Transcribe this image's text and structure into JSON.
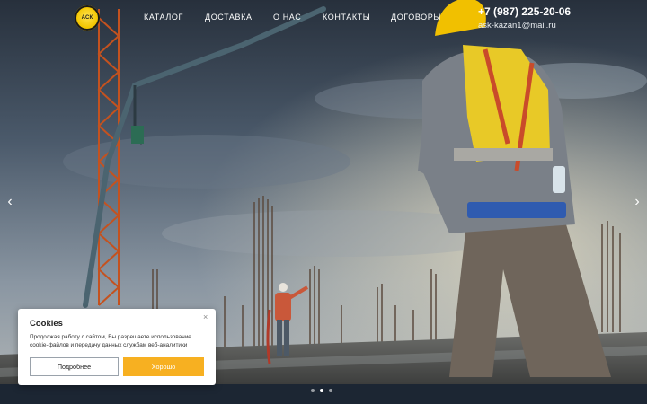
{
  "logo": {
    "text": "АСК",
    "icon": "company-logo"
  },
  "nav": {
    "items": [
      {
        "label": "КАТАЛОГ"
      },
      {
        "label": "ДОСТАВКА"
      },
      {
        "label": "О НАС"
      },
      {
        "label": "КОНТАКТЫ"
      },
      {
        "label": "ДОГОВОРЫ"
      }
    ]
  },
  "contacts": {
    "phone": "+7 (987) 225-20-06",
    "email": "ask-kazan1@mail.ru"
  },
  "slider": {
    "prev_icon": "chevron-left-icon",
    "next_icon": "chevron-right-icon",
    "prev_glyph": "‹",
    "next_glyph": "›",
    "dots_count": 3,
    "active_dot": 2
  },
  "cookie": {
    "title": "Cookies",
    "text": "Продолжая работу с сайтом, Вы разрешаете использование cookie-файлов и передачу данных службам веб-аналитики",
    "close_glyph": "×",
    "more_label": "Подробнее",
    "ok_label": "Хорошо"
  },
  "colors": {
    "accent": "#f7b021",
    "vest": "#e8c927",
    "sky": "#5c6d80"
  }
}
